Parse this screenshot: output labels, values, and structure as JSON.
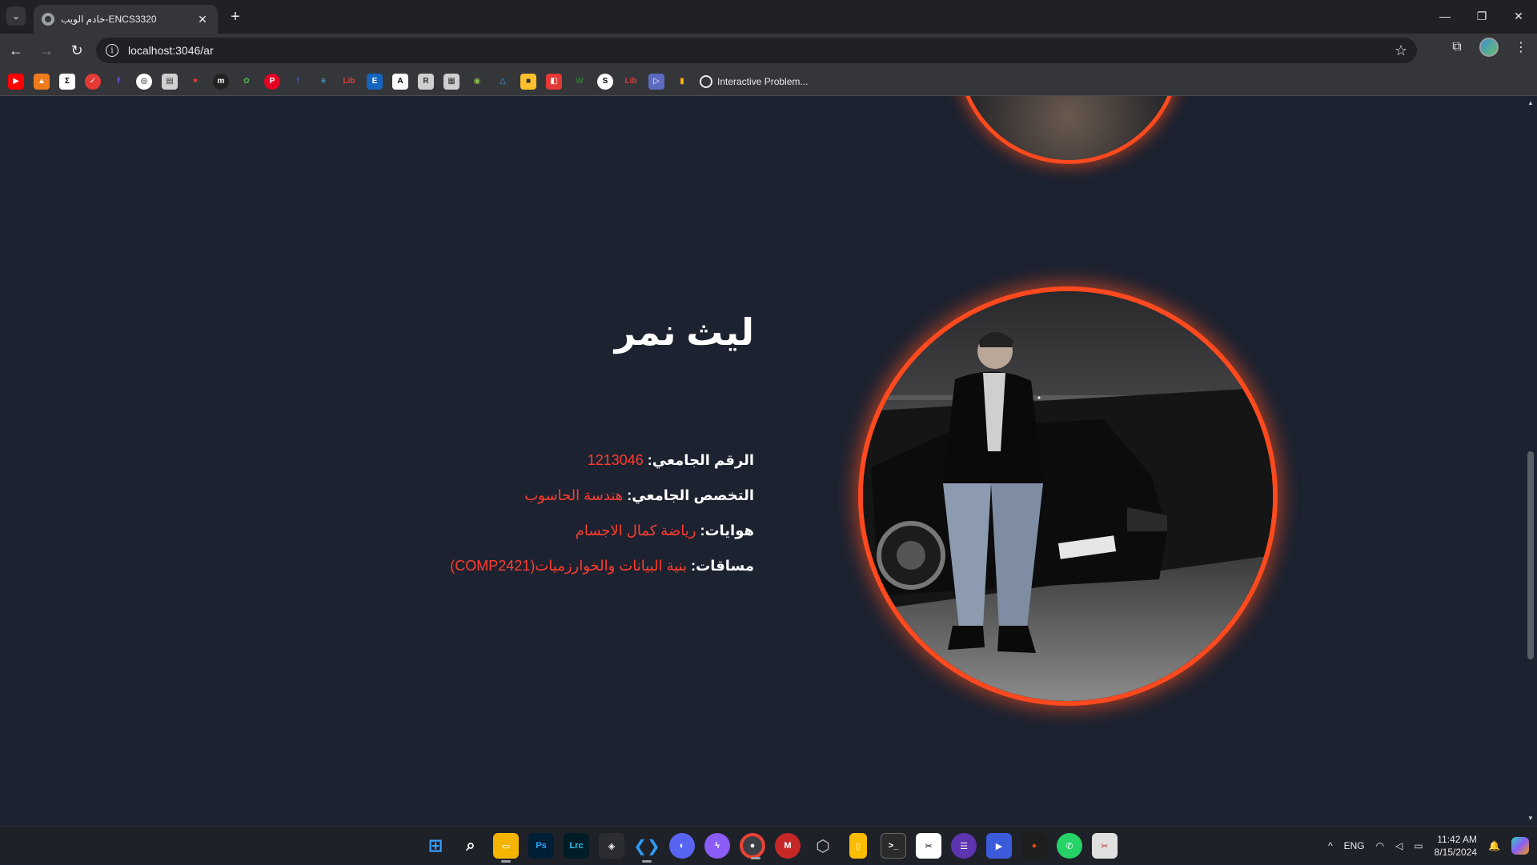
{
  "browser": {
    "tab_title": "خادم الويب-ENCS3320",
    "url": "localhost:3046/ar",
    "new_tab_symbol": "+",
    "bookmark_folder_label": "Interactive Problem..."
  },
  "profile": {
    "name": "ليث نمر",
    "rows": [
      {
        "label": "الرقم الجامعي:",
        "value": "1213046"
      },
      {
        "label": "التخصص الجامعي:",
        "value": "هندسة الحاسوب"
      },
      {
        "label": "هوايات:",
        "value": "رياضة كمال الاجسام"
      },
      {
        "label": "مساقات:",
        "value": "بنية البيانات والخوارزميات(COMP2421)"
      }
    ],
    "accent_color": "#ff4a1f",
    "value_color": "#ff3d2e"
  },
  "taskbar": {
    "language": "ENG",
    "time": "11:42 AM",
    "date": "8/15/2024"
  }
}
